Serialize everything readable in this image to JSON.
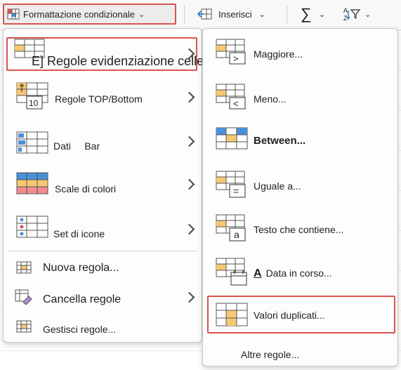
{
  "ribbon": {
    "conditional_formatting_label": "Formattazione condizionale",
    "insert_label": "Inserisci",
    "sum_icon": "autosum-icon",
    "sort_icon": "sort-filter-icon"
  },
  "left_menu": {
    "items": [
      {
        "label": "E] Regole evidenziazione celle",
        "icon": "highlight-cells-rules-icon"
      },
      {
        "label": "Regole TOP/Bottom",
        "icon": "top-bottom-rules-icon",
        "badge": "10"
      },
      {
        "label": "Dati     Bar",
        "icon": "data-bars-icon"
      },
      {
        "label": "Scale di colori",
        "icon": "color-scales-icon"
      },
      {
        "label": "Set di icone",
        "icon": "icon-sets-icon"
      },
      {
        "label": "Nuova regola...",
        "icon": "new-rule-icon"
      },
      {
        "label": "Cancella regole",
        "icon": "clear-rules-icon"
      },
      {
        "label": "Gestisci regole...",
        "icon": "manage-rules-icon"
      }
    ]
  },
  "right_menu": {
    "items": [
      {
        "label": "Maggiore...",
        "icon": "greater-than-icon",
        "glyph": ">"
      },
      {
        "label": "Meno...",
        "icon": "less-than-icon",
        "glyph": "<"
      },
      {
        "label": "Between...",
        "icon": "between-icon"
      },
      {
        "label": "Uguale a...",
        "icon": "equal-to-icon",
        "glyph": "="
      },
      {
        "label": "Testo che contiene...",
        "icon": "text-contains-icon",
        "glyph": "a"
      },
      {
        "label": "Data in corso...",
        "icon": "date-occurring-icon",
        "glyph": "A"
      },
      {
        "label": "Valori duplicati...",
        "icon": "duplicate-values-icon"
      },
      {
        "label": "Altre regole...",
        "icon": ""
      }
    ]
  },
  "colors": {
    "highlight_red": "#d9534f",
    "cell_orange": "#f7c873",
    "cell_blue": "#4a90d9",
    "cell_red": "#f28b8b"
  }
}
